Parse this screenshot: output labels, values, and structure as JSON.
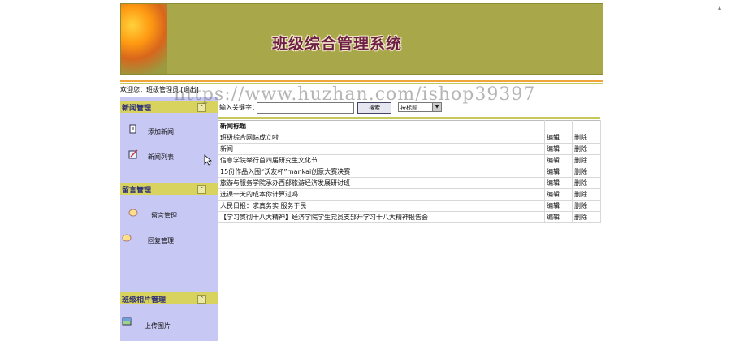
{
  "banner": {
    "title": "班级综合管理系统"
  },
  "welcome": {
    "text": "欢迎您：班级管理员",
    "logout": "[退出]"
  },
  "sidebar": {
    "sections": [
      {
        "title": "新闻管理",
        "items": [
          "添加新闻",
          "新闻列表"
        ]
      },
      {
        "title": "留言管理",
        "items": [
          "留言管理",
          "回复管理"
        ]
      },
      {
        "title": "班级相片管理",
        "items": [
          "上传图片"
        ]
      }
    ]
  },
  "search": {
    "label": "输入关键字：",
    "button": "搜索",
    "select_value": "按标题"
  },
  "table": {
    "headers": [
      "新闻标题",
      "",
      ""
    ],
    "rows": [
      {
        "title": "班级综合网站成立啦",
        "edit": "编辑",
        "del": "删除"
      },
      {
        "title": "新闻",
        "edit": "编辑",
        "del": "删除"
      },
      {
        "title": "信息学院举行首四届研究生文化节",
        "edit": "编辑",
        "del": "删除"
      },
      {
        "title": "15份作品入围“沃友杯”rnankai创意大赛决赛",
        "edit": "编辑",
        "del": "删除"
      },
      {
        "title": "旅游与服务学院承办西部旅游经济发展研讨班",
        "edit": "编辑",
        "del": "删除"
      },
      {
        "title": "选课一天的成本你计算过吗",
        "edit": "编辑",
        "del": "删除"
      },
      {
        "title": "人民日报：求真务实  服务于民",
        "edit": "编辑",
        "del": "删除"
      },
      {
        "title": "【学习贯彻十八大精神】经济学院学生党员支部开学习十八大精神报告会",
        "edit": "编辑",
        "del": "删除"
      }
    ]
  },
  "watermark": "https://www.huzhan.com/ishop39397",
  "colors": {
    "banner": "#a8a84a",
    "sidebar": "#c8c8f5",
    "section_header": "#d7d35e",
    "accent_stripe": "#f0a43a"
  },
  "icons": [
    "page-add-icon",
    "edit-list-icon",
    "message-icon",
    "reply-icon",
    "picture-upload-icon",
    "collapse-icon",
    "cursor-icon"
  ]
}
